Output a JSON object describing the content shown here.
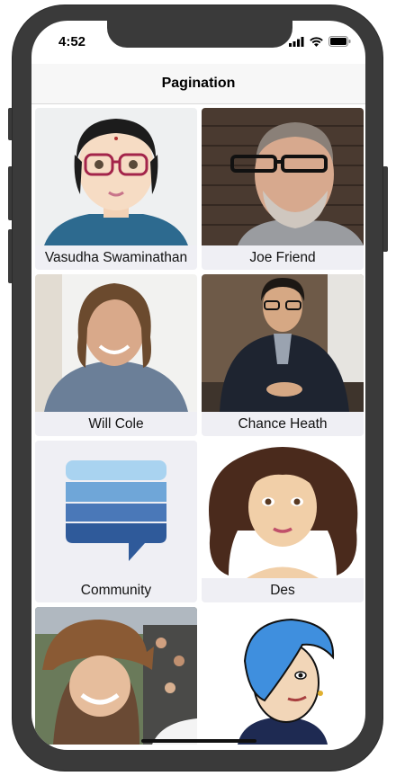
{
  "status_bar": {
    "time": "4:52"
  },
  "nav": {
    "title": "Pagination"
  },
  "contacts": [
    {
      "name": "Vasudha Swaminathan",
      "avatar": "cartoon-woman-glasses-avatar"
    },
    {
      "name": "Joe Friend",
      "avatar": "man-glasses-photo"
    },
    {
      "name": "Will Cole",
      "avatar": "man-long-hair-photo"
    },
    {
      "name": "Chance Heath",
      "avatar": "man-glasses-seated-photo"
    },
    {
      "name": "Community",
      "avatar": "chat-bubble-icon"
    },
    {
      "name": "Des",
      "avatar": "cartoon-woman-curly-hair-avatar"
    },
    {
      "name": "",
      "avatar": "woman-animal-hat-photo"
    },
    {
      "name": "",
      "avatar": "cartoon-blue-hair-avatar"
    }
  ],
  "colors": {
    "caption_bg": "#efeff4",
    "navbar_bg": "#f7f7f7",
    "bezel": "#3a3a3a",
    "community_blue": "#4a78b8"
  }
}
